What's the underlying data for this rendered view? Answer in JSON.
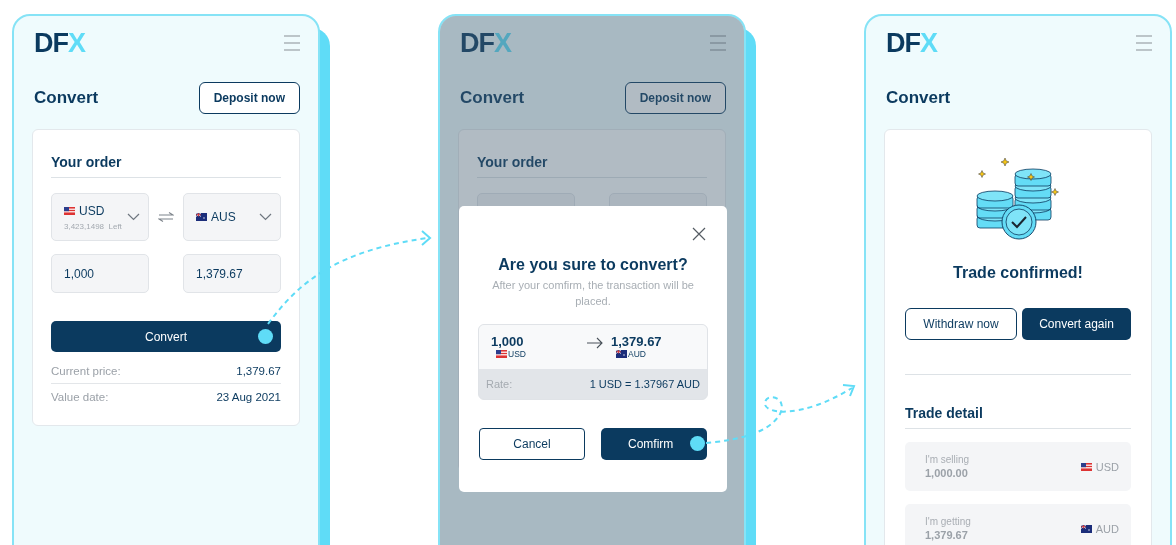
{
  "screens": [
    {
      "kind": "order",
      "logo": "DFX",
      "title": "Convert",
      "deposit_button": "Deposit now",
      "card_title": "Your order",
      "from": {
        "kind": "us",
        "currency": "USD",
        "balance": "3,423,1498  Left"
      },
      "to": {
        "kind": "au",
        "currency": "AUS"
      },
      "from_amount": "1,000",
      "to_amount": "1,379.67",
      "convert_button": "Convert",
      "details": [
        {
          "label": "Current price:",
          "value": "1,379.67"
        },
        {
          "label": "Value date:",
          "value": "23 Aug 2021"
        }
      ]
    },
    {
      "kind": "confirm",
      "logo": "DFX",
      "title": "Convert",
      "deposit_button": "Deposit now",
      "card_title": "Your order",
      "dialog": {
        "title": "Are you sure to convert?",
        "message": "After your comfirm, the transaction will be placed.",
        "from": {
          "kind": "us",
          "amount": "1,000",
          "currency": "USD"
        },
        "to": {
          "kind": "au",
          "amount": "1,379.67",
          "currency": "AUD"
        },
        "rate_label": "Rate:",
        "rate": "1 USD = 1.37967 AUD",
        "cancel_button": "Cancel",
        "confirm_button": "Comfirm"
      }
    },
    {
      "kind": "success",
      "logo": "DFX",
      "title": "Convert",
      "heading": "Trade confirmed!",
      "withdraw_button": "Withdraw now",
      "again_button": "Convert again",
      "detail_title": "Trade detail",
      "rows": [
        {
          "kind": "us",
          "label": "I'm selling",
          "amount": "1,000.00",
          "currency": "USD"
        },
        {
          "kind": "au",
          "label": "I'm getting",
          "amount": "1,379.67",
          "currency": "AUD"
        }
      ]
    }
  ]
}
